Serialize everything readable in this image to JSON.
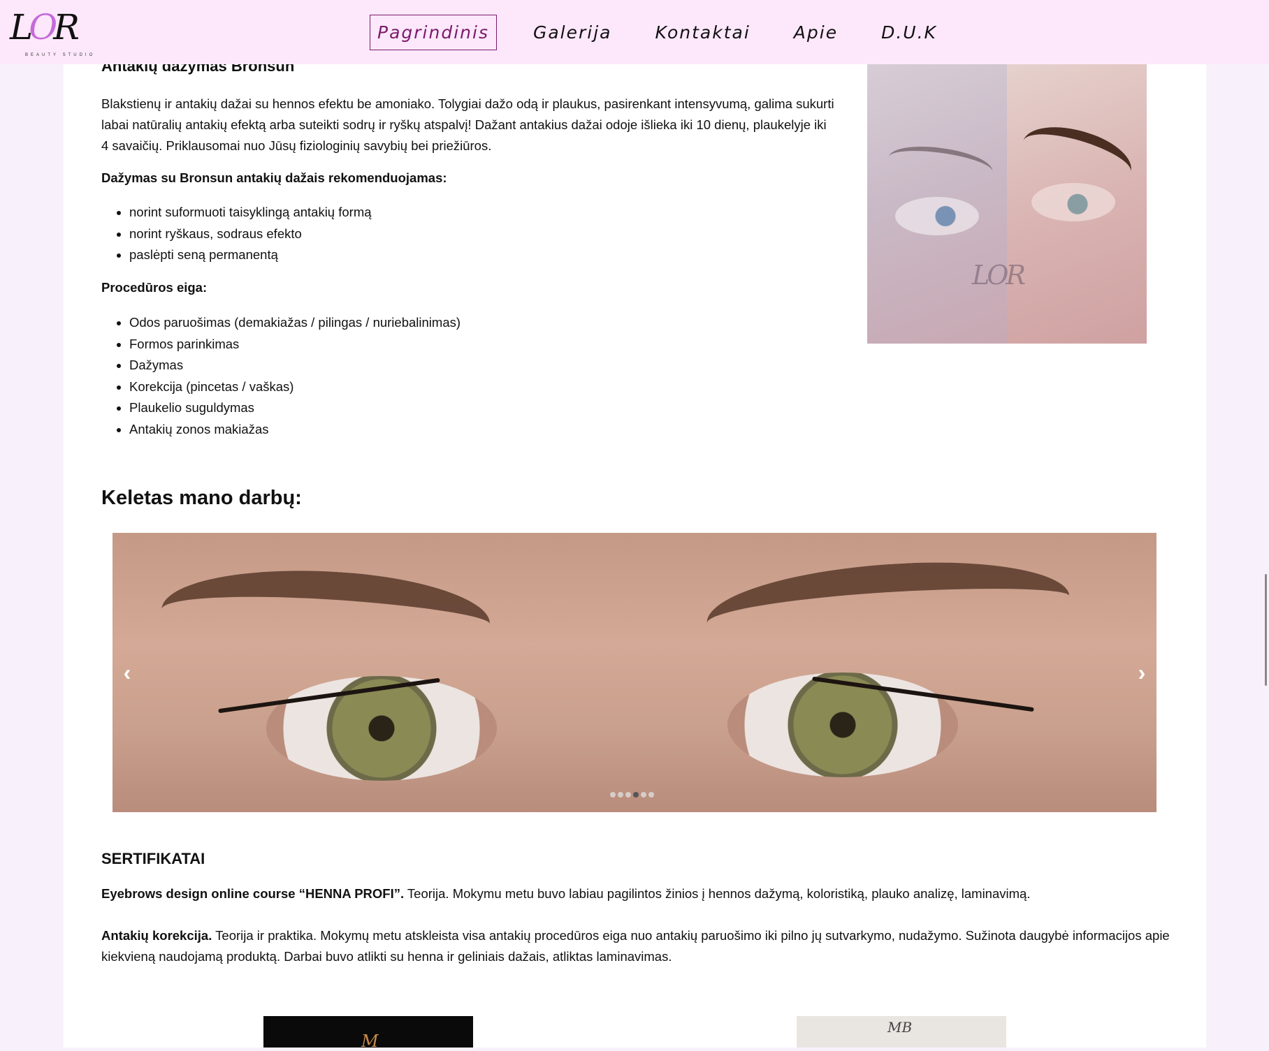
{
  "brand": {
    "logo_text": "L",
    "logo_o": "O",
    "logo_end": "R",
    "logo_sub": "BEAUTY STUDIO"
  },
  "nav": {
    "items": [
      "Pagrindinis",
      "Galerija",
      "Kontaktai",
      "Apie",
      "D.U.K"
    ],
    "active_index": 0
  },
  "service": {
    "title": "Antakių dažymas Bronsun",
    "description": "Blakstienų ir antakių dažai su hennos efektu be amoniako. Tolygiai dažo odą ir plaukus, pasirenkant intensyvumą, galima sukurti labai natūralių antakių efektą arba suteikti sodrų ir ryškų atspalvį! Dažant antakius dažai odoje išlieka iki 10 dienų, plaukelyje iki 4 savaičių. Priklausomai nuo Jūsų fiziologinių savybių bei priežiūros.",
    "recommended_title": "Dažymas su Bronsun antakių dažais rekomenduojamas:",
    "recommended": [
      "norint suformuoti taisyklingą antakių formą",
      "norint ryškaus, sodraus efekto",
      "paslėpti seną permanentą"
    ],
    "procedure_title": "Procedūros eiga:",
    "procedure": [
      "Odos paruošimas (demakiažas / pilingas / nuriebalinimas)",
      "Formos parinkimas",
      "Dažymas",
      "Korekcija (pincetas / vaškas)",
      "Plaukelio suguldymas",
      "Antakių zonos makiažas"
    ]
  },
  "works": {
    "title": "Keletas mano darbų:",
    "prev_arrow": "‹",
    "next_arrow": "›",
    "slide_count": 6,
    "active_slide": 3
  },
  "certificates": {
    "title": "SERTIFIKATAI",
    "items": [
      {
        "name": "Eyebrows design online course “HENNA PROFI”.",
        "text": " Teorija. Mokymu metu buvo labiau pagilintos žinios į hennos dažymą, koloristiką, plauko analizę, laminavimą."
      },
      {
        "name": "Antakių korekcija.",
        "text": " Teorija ir praktika. Mokymų metu atskleista visa antakių procedūros eiga nuo antakių paruošimo iki pilno jų sutvarkymo, nudažymo. Sužinota daugybė informacijos apie kiekvieną naudojamą produktą. Darbai buvo atlikti su henna ir geliniais dažais, atliktas laminavimas."
      }
    ],
    "image_marks": [
      "M",
      "MB"
    ]
  },
  "colors": {
    "header_bg": "#fde8fb",
    "page_bg": "#f8f1fb",
    "nav_active": "#7a1a6b",
    "logo_accent": "#c56bd9"
  }
}
